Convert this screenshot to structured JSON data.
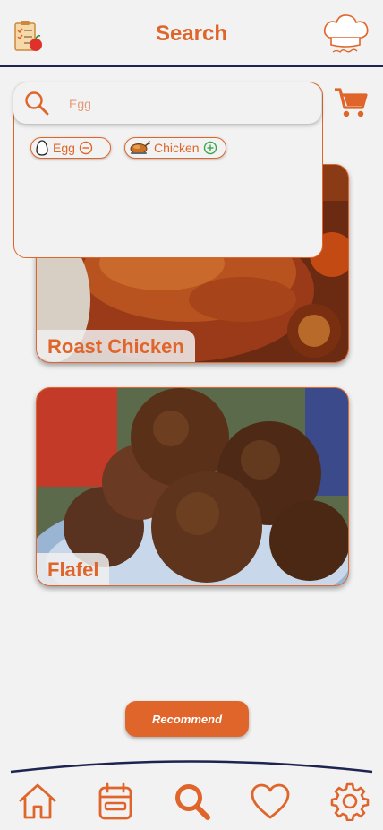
{
  "header": {
    "title": "Search",
    "left_icon": "recipe-checklist-icon",
    "logo": "chef-hat-logo"
  },
  "cart": {
    "icon": "shopping-cart-icon"
  },
  "search": {
    "value": "",
    "placeholder": "Egg",
    "icon": "search-icon"
  },
  "chips": [
    {
      "label": "Egg",
      "icon": "egg-icon",
      "action_icon": "minus-circle-icon",
      "action_color": "#e0652a"
    },
    {
      "label": "Chicken",
      "icon": "roast-chicken-icon",
      "action_icon": "plus-circle-icon",
      "action_color": "#3ea64a"
    }
  ],
  "recipes": [
    {
      "name": "Roast Chicken"
    },
    {
      "name": "Flafel"
    }
  ],
  "recommend_label": "Recommend",
  "nav": [
    {
      "name": "home",
      "icon": "home-icon"
    },
    {
      "name": "calendar",
      "icon": "calendar-icon"
    },
    {
      "name": "search",
      "icon": "search-icon",
      "active": true
    },
    {
      "name": "favorites",
      "icon": "heart-icon"
    },
    {
      "name": "settings",
      "icon": "gear-icon"
    }
  ],
  "colors": {
    "accent": "#e0652a",
    "navy": "#1e2450",
    "background": "#f2f2f2",
    "plus": "#3ea64a"
  }
}
